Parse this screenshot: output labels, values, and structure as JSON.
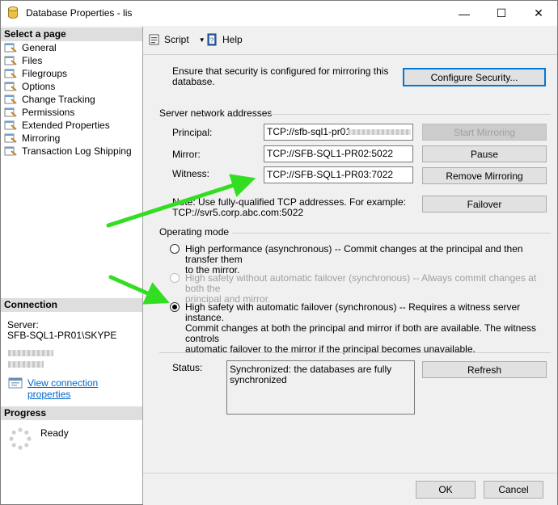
{
  "window": {
    "title": "Database Properties - lis",
    "minimize_glyph": "—",
    "maximize_glyph": "☐",
    "close_glyph": "✕"
  },
  "left_pane": {
    "select_page_header": "Select a page",
    "pages": [
      {
        "label": "General"
      },
      {
        "label": "Files"
      },
      {
        "label": "Filegroups"
      },
      {
        "label": "Options"
      },
      {
        "label": "Change Tracking"
      },
      {
        "label": "Permissions"
      },
      {
        "label": "Extended Properties"
      },
      {
        "label": "Mirroring"
      },
      {
        "label": "Transaction Log Shipping"
      }
    ],
    "connection_header": "Connection",
    "server_label": "Server:",
    "server_value": "SFB-SQL1-PR01\\SKYPE",
    "view_connection_link": "View connection properties",
    "progress_header": "Progress",
    "progress_status": "Ready"
  },
  "toolbar": {
    "script_label": "Script",
    "help_label": "Help"
  },
  "security": {
    "description": "Ensure that security is configured for mirroring this database.",
    "configure_button": "Configure Security..."
  },
  "network": {
    "section_title": "Server network addresses",
    "principal_label": "Principal:",
    "principal_value": "TCP://sfb-sql1-pr01",
    "mirror_label": "Mirror:",
    "mirror_value": "TCP://SFB-SQL1-PR02:5022",
    "witness_label": "Witness:",
    "witness_value": "TCP://SFB-SQL1-PR03:7022",
    "note_line1": "Note: Use fully-qualified TCP addresses. For example:",
    "note_line2": "TCP://svr5.corp.abc.com:5022",
    "start_mirroring_button": "Start Mirroring",
    "pause_button": "Pause",
    "remove_mirroring_button": "Remove Mirroring",
    "failover_button": "Failover"
  },
  "operating_mode": {
    "section_title": "Operating mode",
    "option1_line1": "High performance (asynchronous) -- Commit changes at the principal and then transfer them",
    "option1_line2": "to the mirror.",
    "option2_line1": "High safety without automatic failover (synchronous) -- Always commit changes at both the",
    "option2_line2": "principal and mirror.",
    "option3_line1": "High safety with automatic failover (synchronous) -- Requires a witness server instance.",
    "option3_line2": "Commit changes at both the principal and mirror if both are available. The witness controls",
    "option3_line3": "automatic failover to the mirror if the principal becomes unavailable."
  },
  "status": {
    "label": "Status:",
    "value_line1": "Synchronized: the databases are fully",
    "value_line2": "synchronized",
    "refresh_button": "Refresh"
  },
  "footer": {
    "ok_button": "OK",
    "cancel_button": "Cancel"
  },
  "colors": {
    "arrow": "#33dd22",
    "link": "#0066cc",
    "focus": "#0078d7"
  }
}
